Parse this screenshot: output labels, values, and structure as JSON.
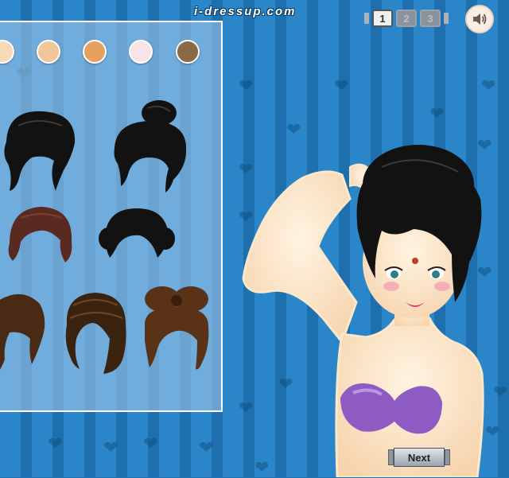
{
  "site": {
    "logo_text": "i-dressup.com"
  },
  "steps": [
    {
      "label": "1",
      "active": true
    },
    {
      "label": "2",
      "active": false
    },
    {
      "label": "3",
      "active": false
    }
  ],
  "sound_button": {
    "icon": "speaker-icon"
  },
  "skin_tones": [
    "#f7d9b8",
    "#f1c79a",
    "#e6a060",
    "#f8e3e6",
    "#8c6a48"
  ],
  "hairstyles": [
    {
      "name": "black-messy-updo",
      "color": "#111111"
    },
    {
      "name": "black-top-bun",
      "color": "#111111"
    },
    {
      "name": "auburn-short",
      "color": "#5a2a20"
    },
    {
      "name": "black-side-buns",
      "color": "#111111"
    },
    {
      "name": "brown-wavy",
      "color": "#4a2a14"
    },
    {
      "name": "brown-braided-crown",
      "color": "#3a2410"
    },
    {
      "name": "brown-bow-bun",
      "color": "#5a3218"
    }
  ],
  "next_button": {
    "label": "Next"
  }
}
